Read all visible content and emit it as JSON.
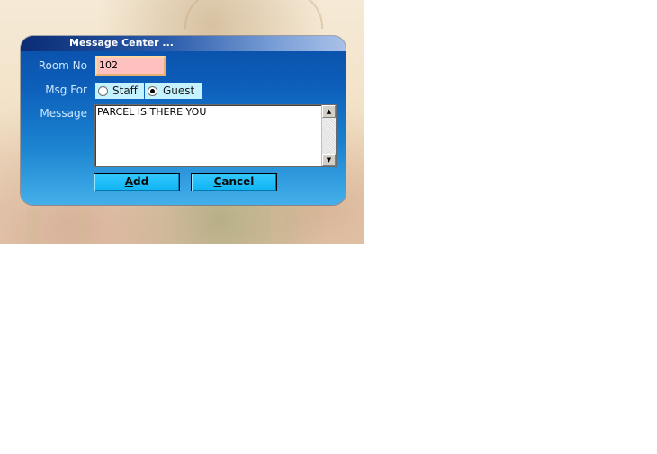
{
  "dialog": {
    "title": "Message Center ..."
  },
  "form": {
    "room_no_label": "Room No",
    "room_no_value": "102",
    "msg_for_label": "Msg For",
    "msg_for_options": [
      {
        "label": "Staff",
        "selected": false
      },
      {
        "label": "Guest",
        "selected": true
      }
    ],
    "message_label": "Message",
    "message_value": "PARCEL IS THERE YOU"
  },
  "buttons": {
    "add": {
      "mnemonic": "A",
      "rest": "dd"
    },
    "cancel": {
      "mnemonic": "C",
      "rest": "ancel"
    }
  },
  "icons": {
    "scroll_up": "scroll-up-arrow-icon",
    "scroll_down": "scroll-down-arrow-icon"
  },
  "colors": {
    "title_bar_start": "#0b2c74",
    "dialog_body": "#0d5fba",
    "room_field": "#ffc0c0",
    "radio_bg": "#c4f2ff",
    "button": "#1ab8f6"
  }
}
